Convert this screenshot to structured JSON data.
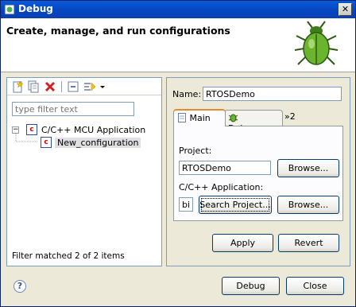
{
  "window": {
    "title": "Debug"
  },
  "banner": {
    "heading": "Create, manage, and run configurations"
  },
  "left": {
    "filter_placeholder": "type filter text",
    "tree": [
      {
        "label": "C/C++ MCU Application",
        "expanded": true
      },
      {
        "label": "New_configuration",
        "selected": true
      }
    ],
    "status": "Filter matched 2 of 2 items"
  },
  "right": {
    "name_label": "Name:",
    "name_value": "RTOSDemo",
    "tabs": [
      {
        "label": "Main"
      },
      {
        "label": "Debugger"
      }
    ],
    "tab_overflow": "»2",
    "project_label": "Project:",
    "project_value": "RTOSDemo",
    "project_browse": "Browse...",
    "app_label": "C/C++ Application:",
    "app_value": "bi",
    "search_project": "Search Project...",
    "app_browse": "Browse...",
    "apply": "Apply",
    "revert": "Revert"
  },
  "footer": {
    "debug": "Debug",
    "close": "Close",
    "help": "?"
  },
  "colors": {
    "title_bar": "#0548c4",
    "config_icon_red": "#d40000",
    "active_tab": "#e68b2c"
  }
}
